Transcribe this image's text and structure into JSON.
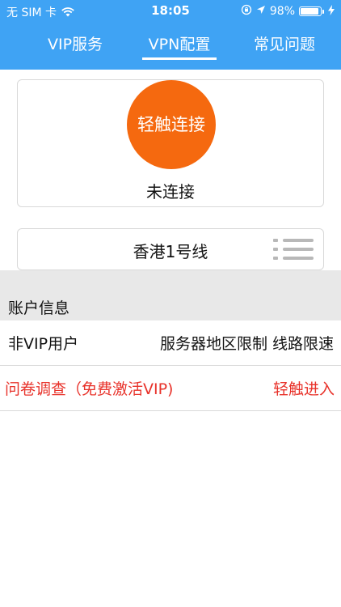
{
  "statusbar": {
    "carrier": "无 SIM 卡",
    "time": "18:05",
    "battery_percent": "98%",
    "battery_level": 0.98,
    "icons": [
      "wifi-icon",
      "orientation-lock-icon",
      "location-icon",
      "battery-icon",
      "charging-icon"
    ]
  },
  "tabs": [
    {
      "label": "VIP服务",
      "active": false
    },
    {
      "label": "VPN配置",
      "active": true
    },
    {
      "label": "常见问题",
      "active": false
    }
  ],
  "connect": {
    "button_label": "轻触连接",
    "status": "未连接"
  },
  "line": {
    "name": "香港1号线",
    "icon": "list-icon"
  },
  "account": {
    "section_title": "账户信息",
    "user_type": "非VIP用户",
    "limits": "服务器地区限制 线路限速"
  },
  "survey": {
    "label": "问卷调查（免费激活VIP)",
    "action": "轻触进入"
  },
  "colors": {
    "header": "#3fa3f4",
    "connect_button": "#f5690f",
    "survey_text": "#e8322a",
    "band": "#e8e8e8"
  }
}
